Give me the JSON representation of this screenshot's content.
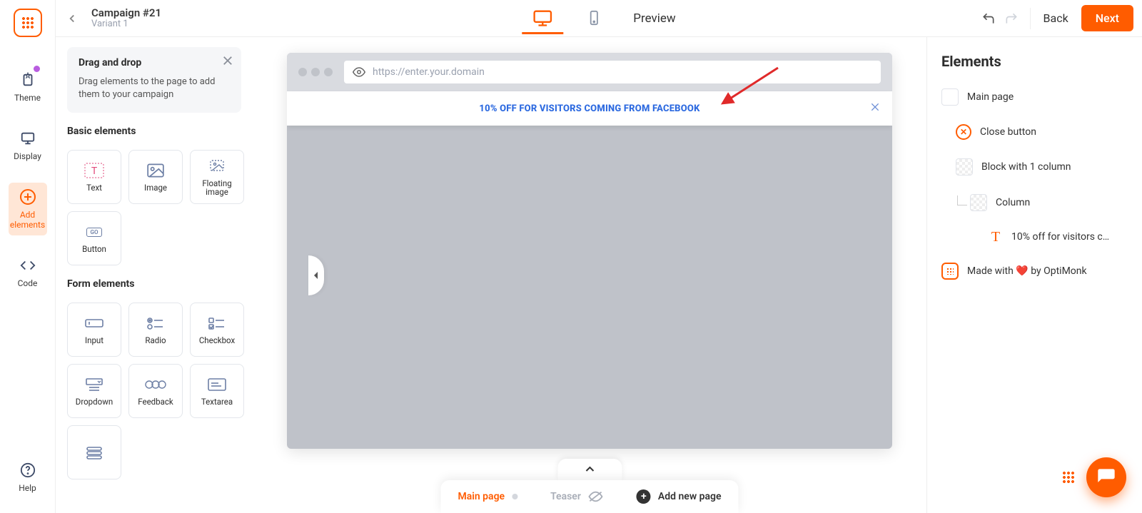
{
  "header": {
    "title": "Campaign #21",
    "subtitle": "Variant 1",
    "preview": "Preview",
    "back": "Back",
    "next": "Next"
  },
  "rail": {
    "theme": "Theme",
    "display": "Display",
    "add_l1": "Add",
    "add_l2": "elements",
    "code": "Code",
    "help": "Help"
  },
  "dnd": {
    "title": "Drag and drop",
    "desc": "Drag elements to the page to add them to your campaign"
  },
  "basic": {
    "heading": "Basic elements",
    "text": "Text",
    "image": "Image",
    "floating_l1": "Floating",
    "floating_l2": "image",
    "button": "Button",
    "go": "GO"
  },
  "form": {
    "heading": "Form elements",
    "input": "Input",
    "radio": "Radio",
    "checkbox": "Checkbox",
    "dropdown": "Dropdown",
    "feedback": "Feedback",
    "textarea": "Textarea"
  },
  "canvas": {
    "url_placeholder": "https://enter.your.domain",
    "banner_text": "10% OFF FOR VISITORS COMING FROM FACEBOOK"
  },
  "pagebar": {
    "main": "Main page",
    "teaser": "Teaser",
    "add": "Add new page"
  },
  "elements": {
    "title": "Elements",
    "main_page": "Main page",
    "close_button": "Close button",
    "block": "Block with 1 column",
    "column": "Column",
    "text_node": "10% off for visitors c…",
    "made_with": "Made with ❤️ by OptiMonk"
  }
}
